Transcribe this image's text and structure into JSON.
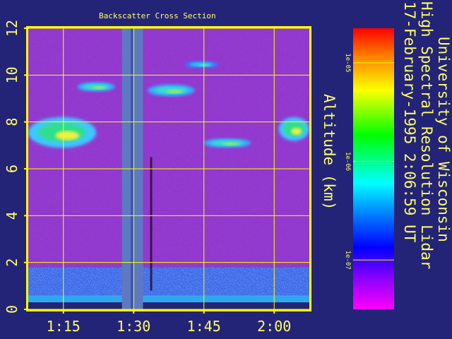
{
  "chart_data": {
    "type": "heatmap",
    "title": "Backscatter Cross Section",
    "ylabel": "Altitude (km)",
    "ylim": [
      0,
      12
    ],
    "y_ticks": [
      "0",
      "2",
      "4",
      "6",
      "8",
      "10",
      "12"
    ],
    "x_ticks": [
      "1:15",
      "1:30",
      "1:45",
      "2:00"
    ],
    "x_tick_minutes": [
      75,
      90,
      105,
      120
    ],
    "xlim_minutes": [
      67.5,
      127.5
    ],
    "grid": true,
    "colorbar": {
      "scale": "log",
      "tick_labels": [
        "1e-05",
        "1e-06",
        "1e-07"
      ],
      "tick_values": [
        1e-05,
        1e-06,
        1e-07
      ],
      "colors_top_to_bottom": [
        "#ff0000",
        "#ff8000",
        "#ffff00",
        "#00ff00",
        "#00ffff",
        "#0080ff",
        "#0000ff",
        "#8000ff",
        "#ff00ff"
      ]
    },
    "data_gap_minutes": [
      87.5,
      92.0
    ],
    "cloud_layers": [
      {
        "t_start": 67.5,
        "t_end": 82.0,
        "alt_bottom": 6.9,
        "alt_top": 8.2,
        "intensity": "high"
      },
      {
        "t_start": 78.0,
        "t_end": 86.0,
        "alt_bottom": 9.3,
        "alt_top": 9.7,
        "intensity": "medium"
      },
      {
        "t_start": 93.0,
        "t_end": 103.0,
        "alt_bottom": 9.1,
        "alt_top": 9.6,
        "intensity": "medium"
      },
      {
        "t_start": 101.0,
        "t_end": 108.0,
        "alt_bottom": 10.3,
        "alt_top": 10.6,
        "intensity": "low"
      },
      {
        "t_start": 105.0,
        "t_end": 115.0,
        "alt_bottom": 6.9,
        "alt_top": 7.3,
        "intensity": "medium"
      },
      {
        "t_start": 121.0,
        "t_end": 127.5,
        "alt_bottom": 7.2,
        "alt_top": 8.2,
        "intensity": "high"
      }
    ],
    "boundary_layer_top_km": 1.8
  },
  "header": {
    "institution": "University of Wisconsin",
    "instrument": "High Spectral Resolution Lidar",
    "datetime": "17-February-1995   2:06:59 UT"
  },
  "colors": {
    "background": "#232478",
    "axis_frame": "#ffff00",
    "grid": "#ffff00",
    "text": "#ffff66"
  }
}
